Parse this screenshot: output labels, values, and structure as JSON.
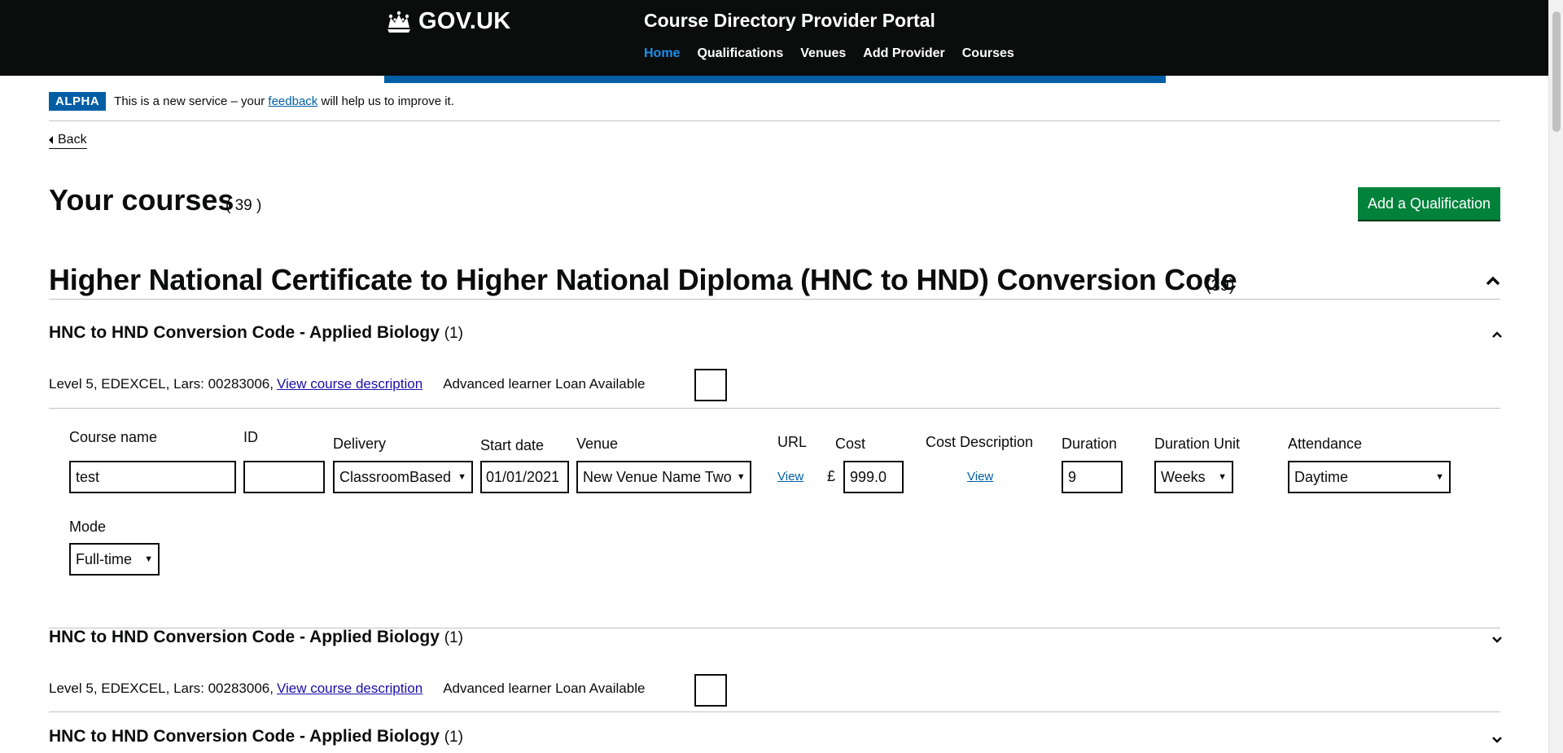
{
  "header": {
    "logo_text": "GOV.UK",
    "service_name": "Course Directory Provider Portal",
    "nav": [
      {
        "label": "Home",
        "active": true
      },
      {
        "label": "Qualifications",
        "active": false
      },
      {
        "label": "Venues",
        "active": false
      },
      {
        "label": "Add Provider",
        "active": false
      },
      {
        "label": "Courses",
        "active": false
      }
    ]
  },
  "phase": {
    "tag": "ALPHA",
    "text_before": "This is a new service – your",
    "link": "feedback",
    "text_after": "will help us to improve it."
  },
  "back_label": "Back",
  "page": {
    "title": "Your courses",
    "count": "( 39 )",
    "add_button": "Add a Qualification"
  },
  "qualification": {
    "title": "Higher National Certificate to Higher National Diploma (HNC to HND) Conversion Code",
    "count": "(39)"
  },
  "courses": [
    {
      "title": "HNC to HND Conversion Code - Applied Biology",
      "count": "(1)",
      "meta": "Level 5, EDEXCEL, Lars: 00283006,",
      "desc_link": "View course description",
      "loan_label": "Advanced learner Loan Available",
      "expanded": true
    },
    {
      "title": "HNC to HND Conversion Code - Applied Biology",
      "count": "(1)",
      "meta": "Level 5, EDEXCEL, Lars: 00283006,",
      "desc_link": "View course description",
      "loan_label": "Advanced learner Loan Available",
      "expanded": false
    },
    {
      "title": "HNC to HND Conversion Code - Applied Biology",
      "count": "(1)",
      "expanded": false
    }
  ],
  "run_form": {
    "labels": {
      "course_name": "Course name",
      "id": "ID",
      "delivery": "Delivery",
      "start_date": "Start date",
      "venue": "Venue",
      "url": "URL",
      "cost": "Cost",
      "cost_description": "Cost Description",
      "duration": "Duration",
      "duration_unit": "Duration Unit",
      "attendance": "Attendance",
      "mode": "Mode"
    },
    "values": {
      "course_name": "test",
      "id": "",
      "delivery": "ClassroomBased",
      "start_date": "01/01/2021",
      "venue": "New Venue Name Two",
      "url_link": "View",
      "currency": "£",
      "cost": "999.0",
      "cost_description_link": "View",
      "duration": "9",
      "duration_unit": "Weeks",
      "attendance": "Daytime",
      "mode": "Full-time"
    }
  },
  "colors": {
    "header_bg": "#0b0c0c",
    "nav_active": "#1d8feb",
    "brand_blue": "#005ea5",
    "button_green": "#00823b"
  }
}
